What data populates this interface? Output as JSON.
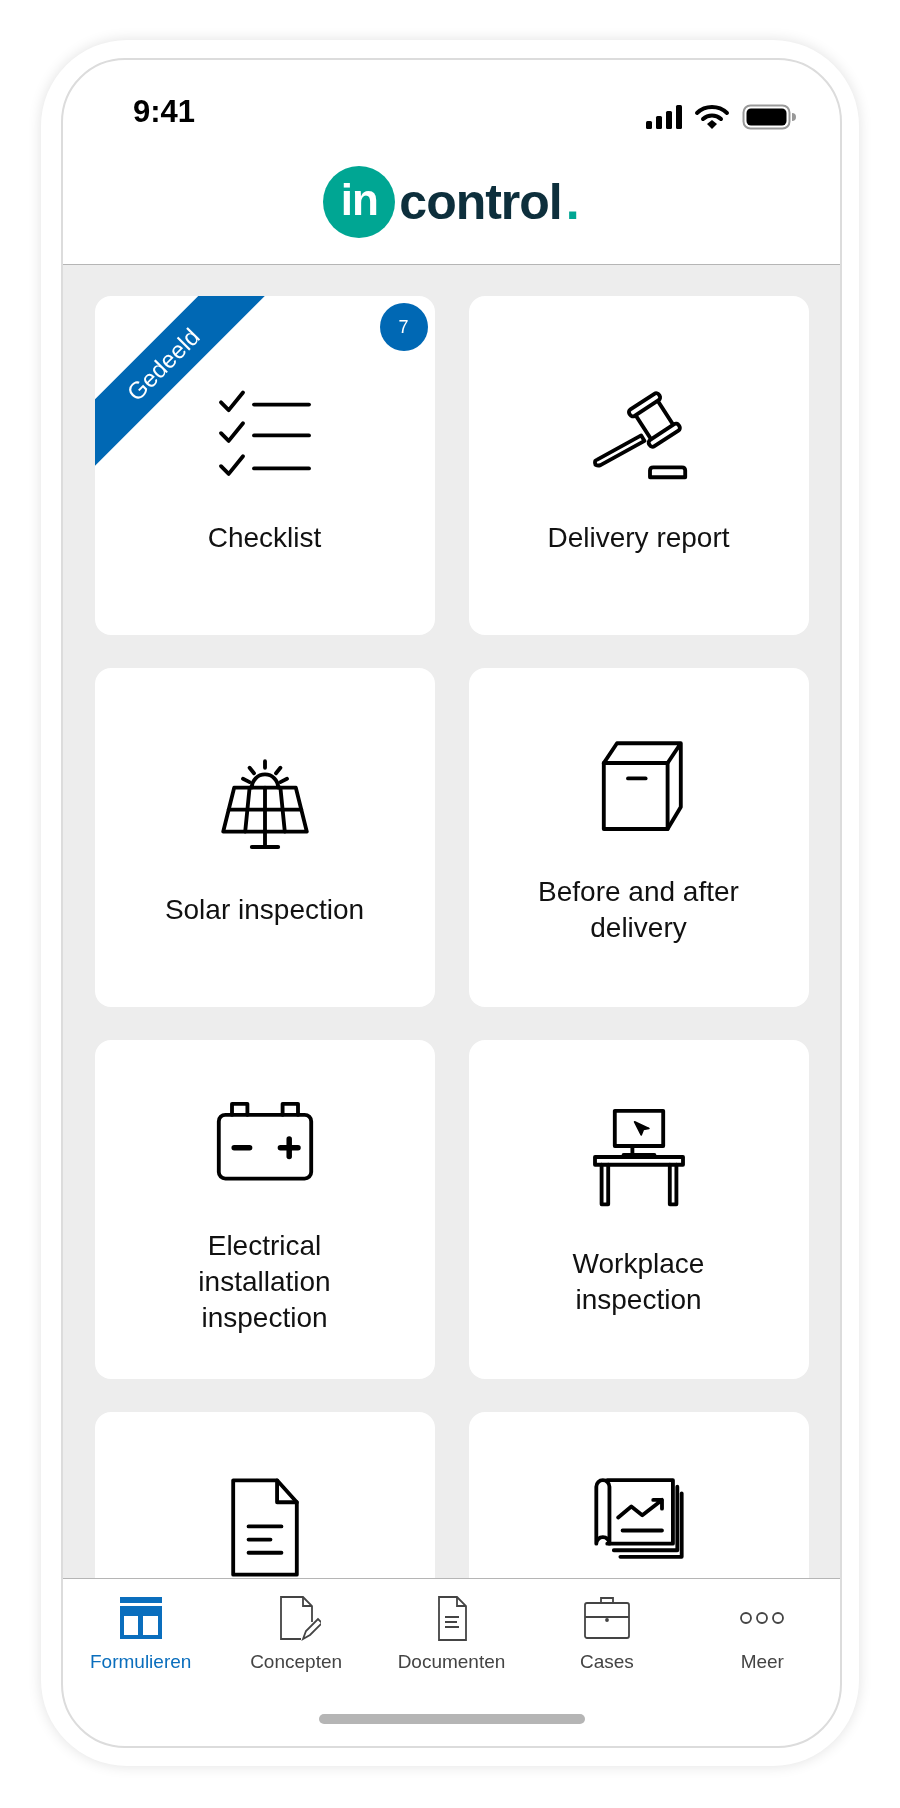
{
  "status_bar": {
    "time": "9:41"
  },
  "logo": {
    "mark": "in",
    "word": "control",
    "dot": "."
  },
  "tiles": [
    {
      "label": "Checklist",
      "kind": "checklist",
      "ribbon": "Gedeeld",
      "badge": "7"
    },
    {
      "label": "Delivery report",
      "kind": "gavel"
    },
    {
      "label": "Solar inspection",
      "kind": "solar"
    },
    {
      "label": "Before and after delivery",
      "kind": "box"
    },
    {
      "label": "Electrical installation inspection",
      "kind": "battery"
    },
    {
      "label": "Workplace inspection",
      "kind": "desk"
    },
    {
      "kind": "document"
    },
    {
      "kind": "blueprint"
    }
  ],
  "tab_bar": [
    {
      "label": "Formulieren",
      "kind": "forms",
      "selected": true
    },
    {
      "label": "Concepten",
      "kind": "draft",
      "selected": false
    },
    {
      "label": "Documenten",
      "kind": "doc",
      "selected": false
    },
    {
      "label": "Cases",
      "kind": "briefcase",
      "selected": false
    },
    {
      "label": "Meer",
      "kind": "more",
      "selected": false
    }
  ]
}
